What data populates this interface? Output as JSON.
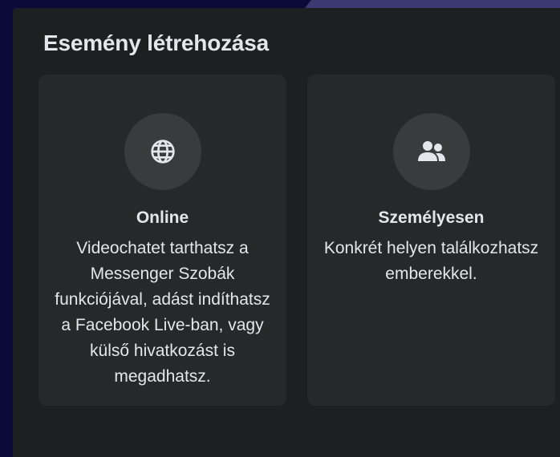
{
  "dialog": {
    "title": "Esemény létrehozása"
  },
  "options": [
    {
      "icon": "globe-icon",
      "title": "Online",
      "description": "Videochatet tarthatsz a Messenger Szobák funkciójával, adást indíthatsz a Facebook Live-ban, vagy külső hivatkozást is megadhatsz."
    },
    {
      "icon": "people-icon",
      "title": "Személyesen",
      "description": "Konkrét helyen találkozhatsz emberekkel."
    }
  ],
  "colors": {
    "panel_background": "#1e1f21",
    "card_background": "#27282a",
    "icon_circle": "#3a3b3c",
    "text": "#e4e6eb",
    "outer_background": "#0b0b3a"
  }
}
